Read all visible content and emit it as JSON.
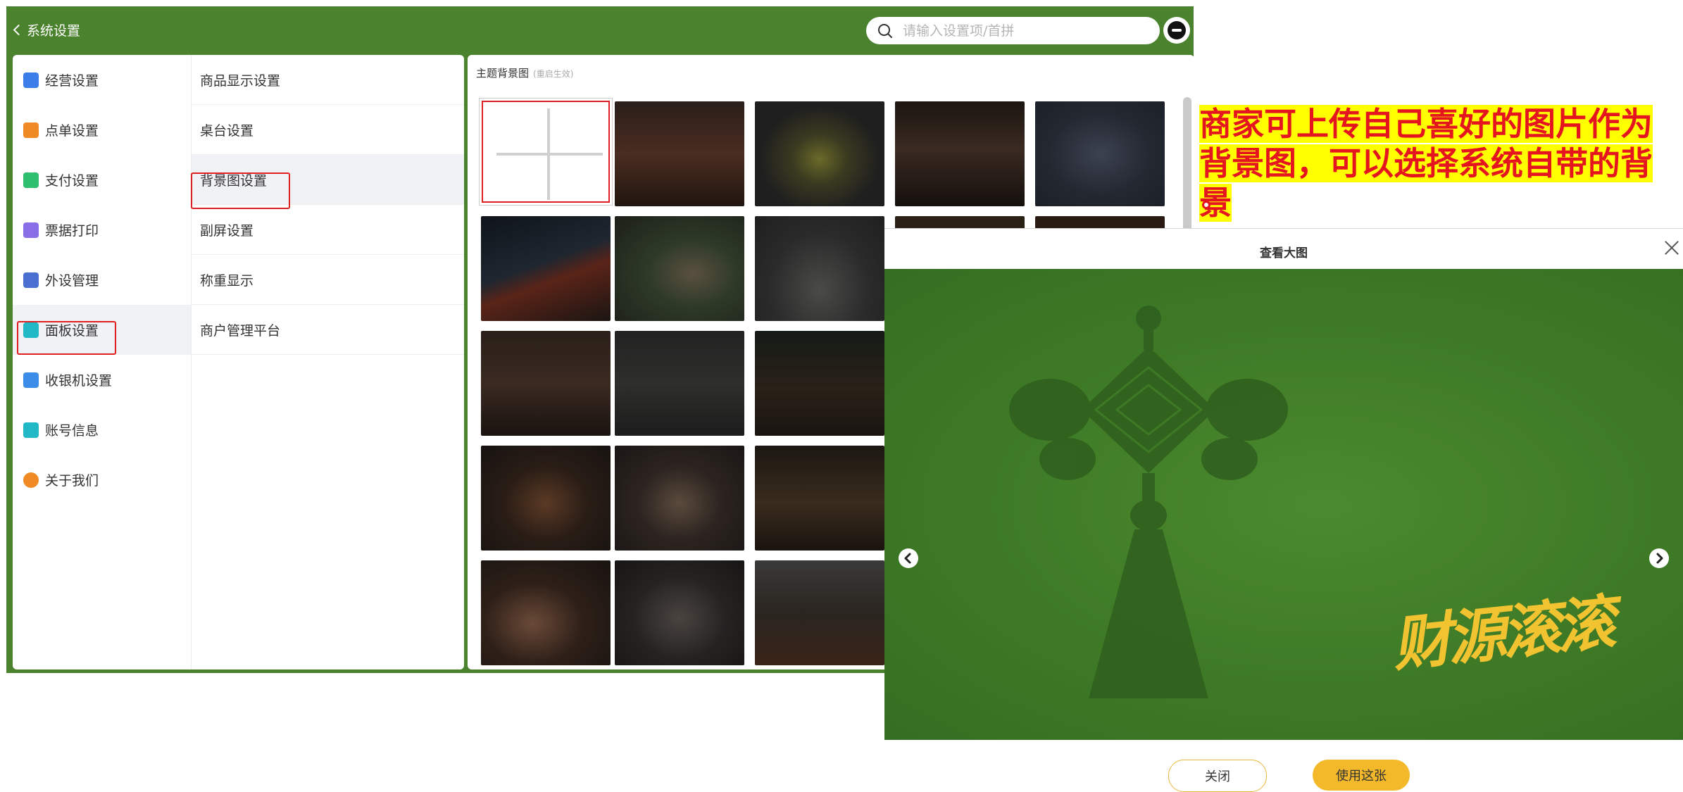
{
  "header": {
    "back_label": "系统设置",
    "search_placeholder": "请输入设置项/首拼"
  },
  "nav_primary": [
    {
      "label": "经营设置",
      "icon": "store-icon",
      "color": "#3b7de9"
    },
    {
      "label": "点单设置",
      "icon": "order-icon",
      "color": "#f08a24"
    },
    {
      "label": "支付设置",
      "icon": "yen-icon",
      "color": "#2fbf71"
    },
    {
      "label": "票据打印",
      "icon": "printer-icon",
      "color": "#8a6ee8"
    },
    {
      "label": "外设管理",
      "icon": "monitor-icon",
      "color": "#4b6fd1"
    },
    {
      "label": "面板设置",
      "icon": "panel-icon",
      "color": "#22b8c5",
      "active": true
    },
    {
      "label": "收银机设置",
      "icon": "cashier-icon",
      "color": "#3b8de9"
    },
    {
      "label": "账号信息",
      "icon": "account-icon",
      "color": "#22b8c5"
    },
    {
      "label": "关于我们",
      "icon": "info-icon",
      "color": "#f08a24"
    }
  ],
  "nav_secondary": [
    {
      "label": "商品显示设置"
    },
    {
      "label": "桌台设置"
    },
    {
      "label": "背景图设置",
      "active": true
    },
    {
      "label": "副屏设置"
    },
    {
      "label": "称重显示"
    },
    {
      "label": "商户管理平台"
    }
  ],
  "backgrounds": {
    "title": "主题背景图",
    "subtitle": "(重启生效)"
  },
  "annotation": {
    "text": "商家可上传自己喜好的图片作为背景图，可以选择系统自带的背景"
  },
  "modal": {
    "title": "查看大图",
    "preview_text": "财源滚滚",
    "close_label": "关闭",
    "use_label": "使用这张"
  },
  "colors": {
    "brand_green": "#4b822d",
    "highlight_red": "#e02020",
    "accent_yellow": "#f3b92a"
  }
}
